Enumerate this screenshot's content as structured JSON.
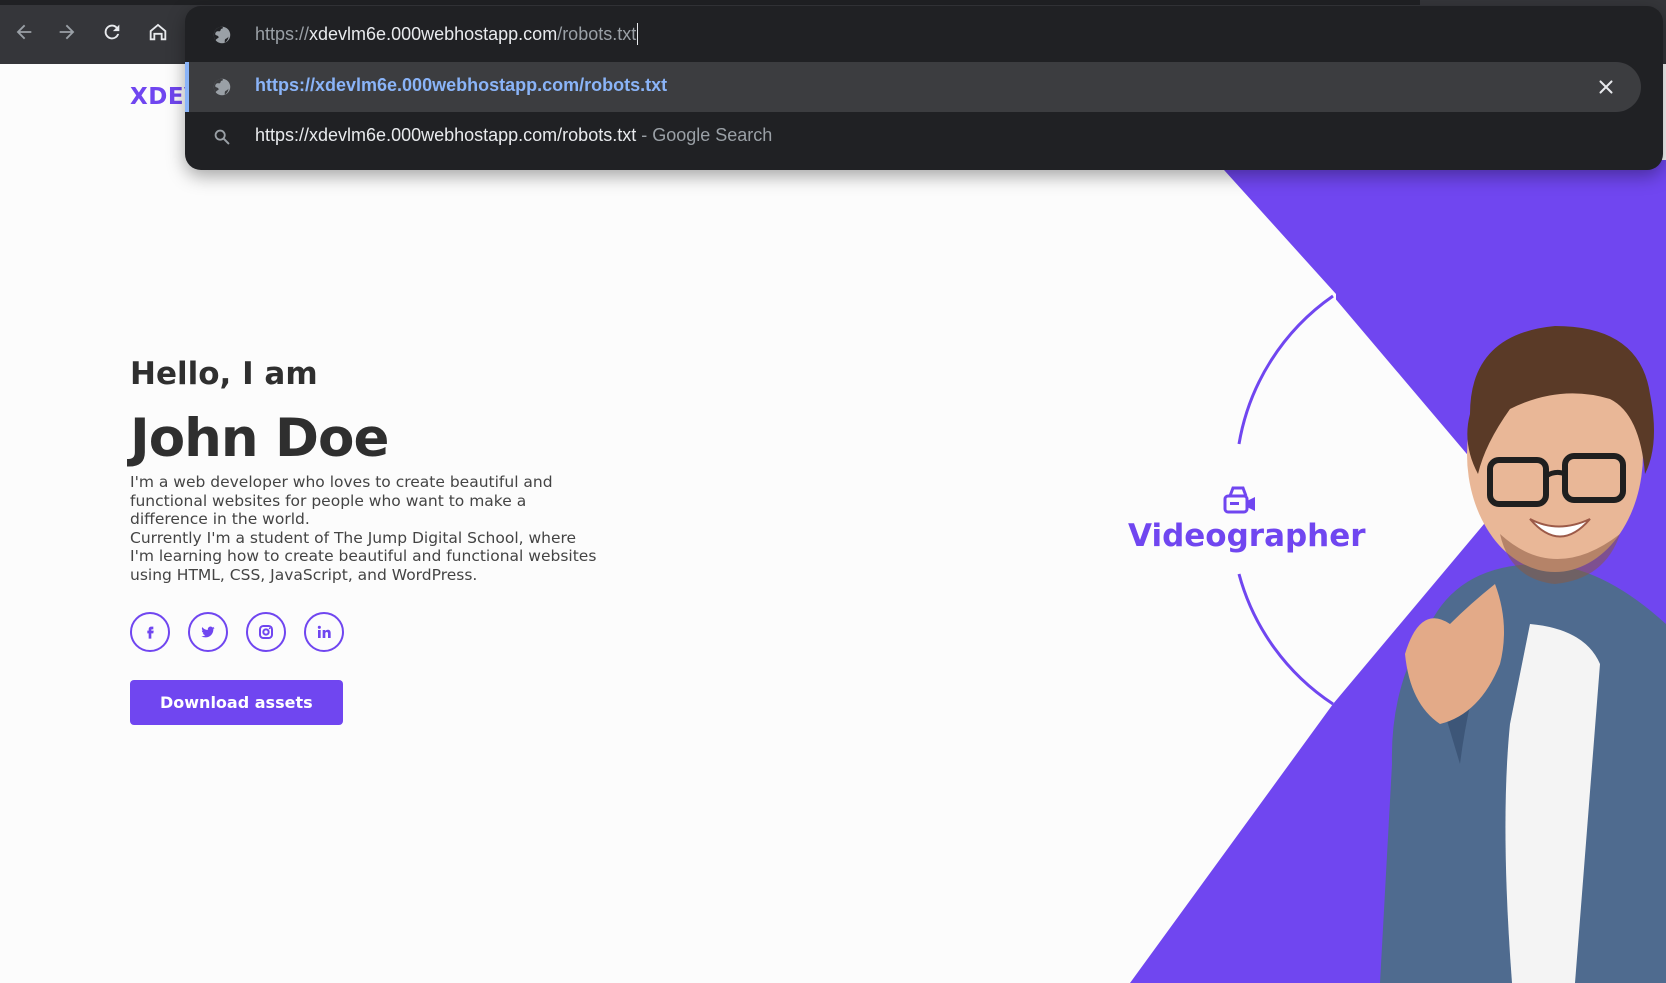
{
  "browser": {
    "address_bar": {
      "scheme": "https://",
      "host": "xdevlm6e.000webhostapp.com",
      "path": "/robots.txt"
    },
    "suggestions": [
      {
        "text": "https://xdevlm6e.000webhostapp.com/robots.txt",
        "icon": "globe-icon",
        "selected": true
      },
      {
        "text": "https://xdevlm6e.000webhostapp.com/robots.txt",
        "suffix": "- Google Search",
        "icon": "search-icon",
        "selected": false
      }
    ]
  },
  "site": {
    "logo": "XDEV",
    "greeting": "Hello, I am",
    "name": "John Doe",
    "bio_1": "I'm a web developer who loves to create beautiful and functional websites for people who want to make a difference in the world.",
    "bio_2": "Currently I'm a student of The Jump Digital School, where I'm learning how to create beautiful and functional websites using HTML, CSS, JavaScript, and WordPress.",
    "socials": [
      "facebook-icon",
      "twitter-icon",
      "instagram-icon",
      "linkedin-icon"
    ],
    "cta_label": "Download assets",
    "role_label": "Videographer",
    "role_icon": "video-camera-icon",
    "colors": {
      "accent": "#7046f0",
      "text": "#2f2f2f",
      "chrome_dark": "#202124"
    }
  }
}
